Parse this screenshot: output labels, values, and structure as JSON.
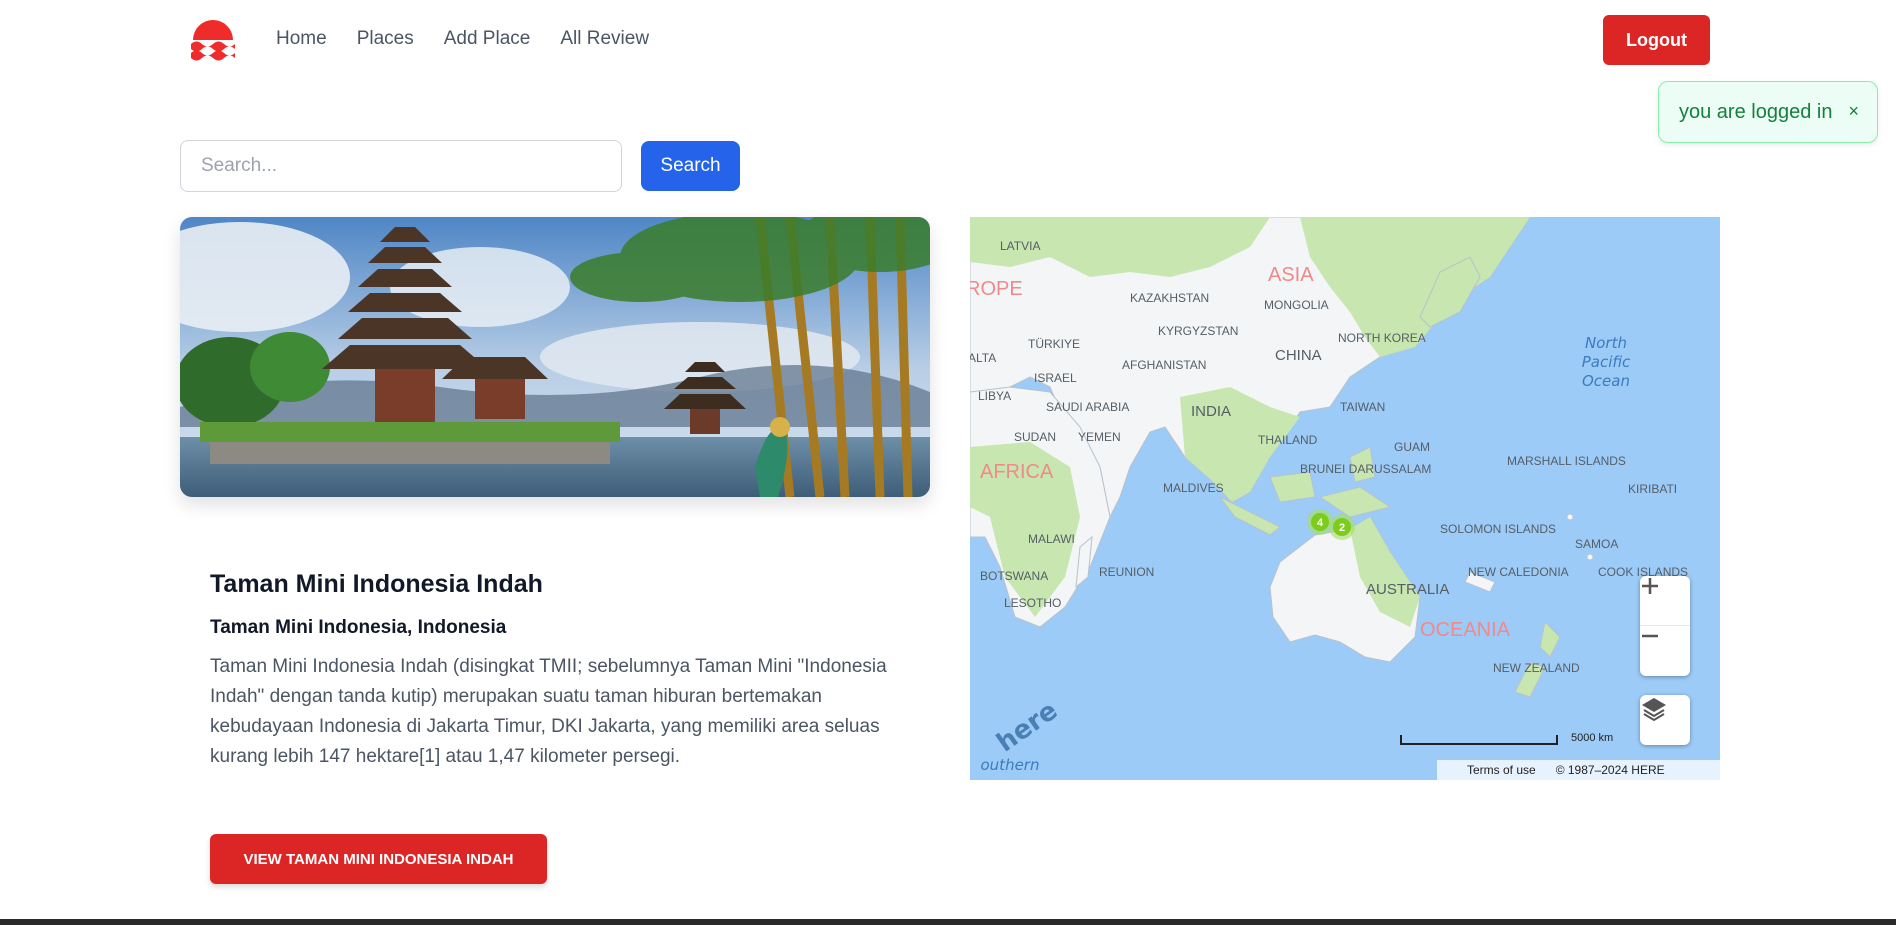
{
  "nav": {
    "links": [
      "Home",
      "Places",
      "Add Place",
      "All Review"
    ],
    "logout_label": "Logout"
  },
  "toast": {
    "message": "you are logged in",
    "close": "×"
  },
  "search": {
    "placeholder": "Search...",
    "button_label": "Search"
  },
  "place": {
    "title": "Taman Mini Indonesia Indah",
    "location": "Taman Mini Indonesia, Indonesia",
    "description": "Taman Mini Indonesia Indah (disingkat TMII; sebelumnya Taman Mini \"Indonesia Indah\" dengan tanda kutip) merupakan suatu taman hiburan bertemakan kebudayaan Indonesia di Jakarta Timur, DKI Jakarta, yang memiliki area seluas kurang lebih 147 hektare[1] atau 1,47 kilometer persegi.",
    "view_button": "VIEW TAMAN MINI INDONESIA INDAH"
  },
  "map": {
    "continents": [
      "ROPE",
      "ASIA",
      "AFRICA",
      "OCEANIA"
    ],
    "countries": [
      "LATVIA",
      "KAZAKHSTAN",
      "MONGOLIA",
      "KYRGYZSTAN",
      "TÜRKIYE",
      "NORTH KOREA",
      "CHINA",
      "AFGHANISTAN",
      "ALTA",
      "ISRAEL",
      "LIBYA",
      "SAUDI ARABIA",
      "INDIA",
      "TAIWAN",
      "SUDAN",
      "YEMEN",
      "THAILAND",
      "GUAM",
      "MARSHALL ISLANDS",
      "MALDIVES",
      "BRUNEI DARUSSALAM",
      "KIRIBATI",
      "SOLOMON ISLANDS",
      "MALAWI",
      "SAMOA",
      "REUNION",
      "NEW CALEDONIA",
      "COOK ISLANDS",
      "BOTSWANA",
      "AUSTRALIA",
      "LESOTHO",
      "NEW ZEALAND"
    ],
    "ocean_label": [
      "North",
      "Pacific",
      "Ocean"
    ],
    "southern_label": "outhern",
    "clusters": [
      "4",
      "2"
    ],
    "zoom_in": "+",
    "zoom_out": "−",
    "scale": "5000 km",
    "terms": "Terms of use",
    "copyright": "© 1987–2024 HERE",
    "brand": "here",
    "colors": {
      "water": "#9ccbf7",
      "land": "#f3f5f7",
      "green": "#c8e6b0",
      "continent_label": "#f08a8a",
      "cluster": "#7ccd1a"
    }
  },
  "colors": {
    "primary_red": "#dc2626",
    "primary_blue": "#2563eb",
    "toast_green": "#15803d"
  }
}
